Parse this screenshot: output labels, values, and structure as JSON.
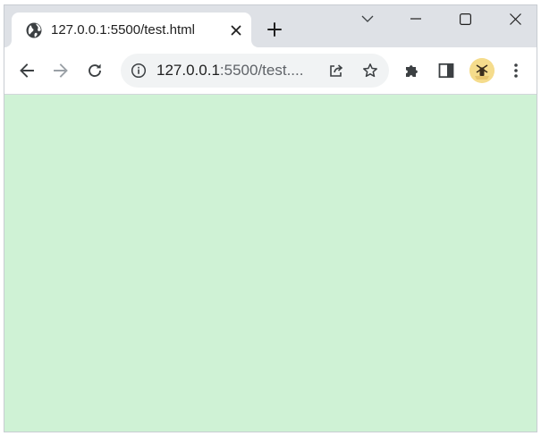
{
  "browser": {
    "tab": {
      "title": "127.0.0.1:5500/test.html",
      "favicon": "globe-icon"
    },
    "new_tab_icon": "plus-icon",
    "window_controls": {
      "tab_search": "chevron-down-icon",
      "minimize": "minimize-icon",
      "maximize": "maximize-icon",
      "close": "close-icon"
    },
    "toolbar": {
      "back": "arrow-left-icon",
      "forward": "arrow-right-icon",
      "reload": "reload-icon",
      "extensions": "puzzle-icon",
      "side_panel": "side-panel-icon",
      "profile": "avatar",
      "menu": "more-vertical-icon"
    },
    "omnibox": {
      "info_icon": "info-icon",
      "url_host": "127.0.0.1",
      "url_rest": ":5500/test....",
      "share_icon": "share-icon",
      "bookmark_icon": "star-icon"
    }
  },
  "page": {
    "background_color": "#cff2d5"
  },
  "colors": {
    "tabstrip": "#dee1e6",
    "omnibox": "#f1f3f4",
    "icon": "#3c4043",
    "icon_disabled": "#9aa0a6"
  }
}
